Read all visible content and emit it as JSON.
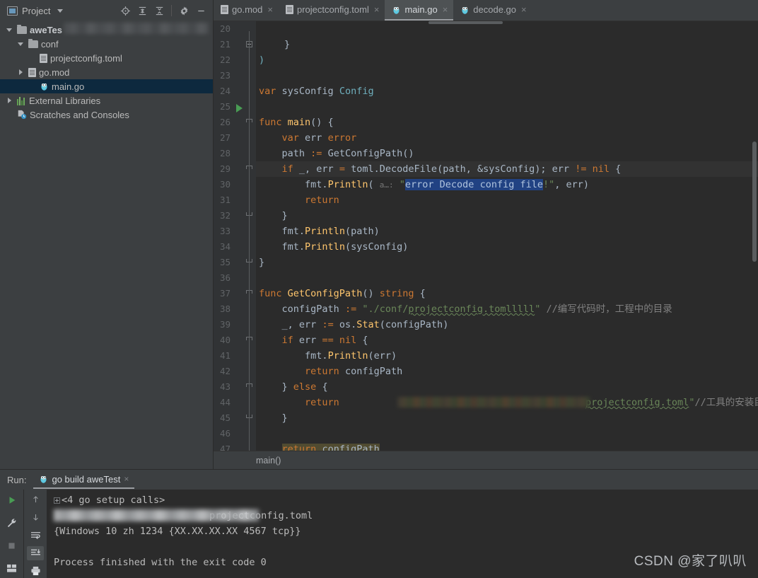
{
  "sidebar": {
    "title": "Project",
    "tools": [
      {
        "name": "locate-icon",
        "label": "Select Opened File"
      },
      {
        "name": "expand-all-icon",
        "label": "Expand All"
      },
      {
        "name": "collapse-all-icon",
        "label": "Collapse All"
      },
      {
        "name": "gear-icon",
        "label": "Settings"
      },
      {
        "name": "minimize-icon",
        "label": "Hide"
      }
    ],
    "tree": [
      {
        "label": "aweTes",
        "indent": 0,
        "twist": "down",
        "icon": "folder-icon",
        "bold": true,
        "selected": false,
        "blurred": true
      },
      {
        "label": "conf",
        "indent": 1,
        "twist": "down",
        "icon": "folder-icon",
        "bold": false,
        "selected": false,
        "blurred": false
      },
      {
        "label": "projectconfig.toml",
        "indent": 2,
        "twist": "none",
        "icon": "file-icon",
        "bold": false,
        "selected": false,
        "blurred": false
      },
      {
        "label": "go.mod",
        "indent": 1,
        "twist": "right",
        "icon": "file-icon",
        "bold": false,
        "selected": false,
        "blurred": false
      },
      {
        "label": "main.go",
        "indent": 2,
        "twist": "none",
        "icon": "gopher-icon",
        "bold": false,
        "selected": true,
        "blurred": false
      },
      {
        "label": "External Libraries",
        "indent": 0,
        "twist": "right",
        "icon": "library-icon",
        "bold": false,
        "selected": false,
        "blurred": false
      },
      {
        "label": "Scratches and Consoles",
        "indent": 0,
        "twist": "none",
        "icon": "scratches-icon",
        "bold": false,
        "selected": false,
        "blurred": false
      }
    ]
  },
  "tabs": [
    {
      "label": "go.mod",
      "icon": "file-icon",
      "active": false,
      "close": "×"
    },
    {
      "label": "projectconfig.toml",
      "icon": "file-icon",
      "active": false,
      "close": "×"
    },
    {
      "label": "main.go",
      "icon": "gopher-icon",
      "active": true,
      "close": "×"
    },
    {
      "label": "decode.go",
      "icon": "gopher-icon",
      "active": false,
      "close": "×"
    }
  ],
  "editor": {
    "first_line": 20,
    "breadcrumb": "main()",
    "lines": [
      {
        "n": 20,
        "text": "    }"
      },
      {
        "n": 21,
        "text": ")"
      },
      {
        "n": 22,
        "text": ""
      },
      {
        "n": 23,
        "text": "var sysConfig Config"
      },
      {
        "n": 24,
        "text": ""
      },
      {
        "n": 25,
        "text": "func main() {"
      },
      {
        "n": 26,
        "text": "    var err error"
      },
      {
        "n": 27,
        "text": "    path := GetConfigPath()"
      },
      {
        "n": 28,
        "text": "    if _, err = toml.DecodeFile(path, &sysConfig); err != nil {"
      },
      {
        "n": 29,
        "text": "        fmt.Println( a…: \"error Decode config file!\", err)"
      },
      {
        "n": 30,
        "text": "        return"
      },
      {
        "n": 31,
        "text": "    }"
      },
      {
        "n": 32,
        "text": "    fmt.Println(path)"
      },
      {
        "n": 33,
        "text": "    fmt.Println(sysConfig)"
      },
      {
        "n": 34,
        "text": "}"
      },
      {
        "n": 35,
        "text": ""
      },
      {
        "n": 36,
        "text": "func GetConfigPath() string {"
      },
      {
        "n": 37,
        "text": "    configPath := \"./conf/projectconfig.tomlllll\" //编写代码时，工程中的目录"
      },
      {
        "n": 38,
        "text": "    _, err := os.Stat(configPath)"
      },
      {
        "n": 39,
        "text": "    if err == nil {"
      },
      {
        "n": 40,
        "text": "        fmt.Println(err)"
      },
      {
        "n": 41,
        "text": "        return configPath"
      },
      {
        "n": 42,
        "text": "    } else {"
      },
      {
        "n": 43,
        "text": "        return █████projectconfig.toml\"//工具的安装目录"
      },
      {
        "n": 44,
        "text": "    }"
      },
      {
        "n": 45,
        "text": ""
      },
      {
        "n": 46,
        "text": "    return configPath"
      },
      {
        "n": 47,
        "text": "}"
      }
    ],
    "tokens": {
      "kw_var": "var",
      "kw_func": "func",
      "kw_if": "if",
      "kw_else": "else",
      "kw_return": "return",
      "kw_nil": "nil",
      "kw_string": "string",
      "name_sysConfig": "sysConfig",
      "type_Config": "Config",
      "name_main": "main",
      "name_err": "err",
      "type_error": "error",
      "name_path": "path",
      "name_GetConfigPath": "GetConfigPath",
      "pkg_toml": "toml",
      "fn_DecodeFile": "DecodeFile",
      "pkg_fmt": "fmt",
      "fn_Println": "Println",
      "param_hint": "a…:",
      "selected_string": "error Decode config file",
      "name_configPath": "configPath",
      "str_configpath": "\"./conf/projectconfig.tomlllll\"",
      "comment_37": "//编写代码时，工程中的目录",
      "pkg_os": "os",
      "fn_Stat": "Stat",
      "str_43_tail": "projectconfig.toml\"",
      "comment_43": "//工具的安装目录"
    },
    "gutter": {
      "run_marker_line": 25,
      "bulb_line": 29
    }
  },
  "run_panel": {
    "label": "Run:",
    "tab_label": "go build aweTest",
    "tab_close": "×",
    "toolbar_left": [
      {
        "name": "run-icon",
        "label": "Rerun"
      },
      {
        "name": "wrench-icon",
        "label": "Settings"
      },
      {
        "name": "stop-icon",
        "label": "Stop"
      },
      {
        "name": "layout-icon",
        "label": "Layout"
      }
    ],
    "toolbar_right": [
      {
        "name": "arrow-up-icon",
        "label": "Up"
      },
      {
        "name": "arrow-down-icon",
        "label": "Down"
      },
      {
        "name": "soft-wrap-icon",
        "label": "Soft-Wrap"
      },
      {
        "name": "scroll-to-end-icon",
        "label": "Scroll to End",
        "active": true
      },
      {
        "name": "print-icon",
        "label": "Print"
      }
    ],
    "console_lines": [
      {
        "text": "<4 go setup calls>",
        "expander": true,
        "blurred": false
      },
      {
        "text": "projectconfig.toml",
        "expander": false,
        "blurred": true
      },
      {
        "text": "{Windows 10 zh 1234 {XX.XX.XX.XX 4567 tcp}}",
        "expander": false,
        "blurred": false
      },
      {
        "text": "",
        "expander": false,
        "blurred": false
      },
      {
        "text": "Process finished with the exit code 0",
        "expander": false,
        "blurred": false
      }
    ]
  },
  "watermark": "CSDN @家了叭叭",
  "colors": {
    "bg_panel": "#3c3f41",
    "bg_editor": "#2b2b2b",
    "gutter": "#313335",
    "selection_blue": "#214283",
    "tree_selected": "#0d293e",
    "keyword": "#cc7832",
    "string": "#6a8759",
    "function": "#ffc66d",
    "comment": "#808080",
    "text": "#a9b7c6",
    "run_green": "#499c54",
    "bulb_yellow": "#f0b433"
  }
}
